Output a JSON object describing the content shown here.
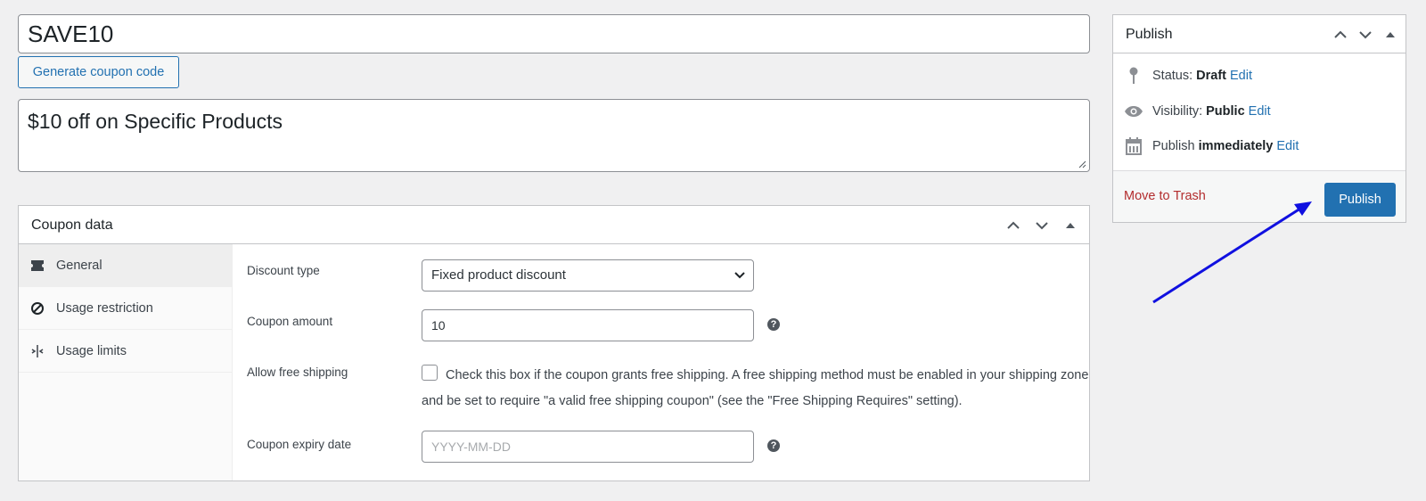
{
  "coupon": {
    "code": "SAVE10",
    "generate_label": "Generate coupon code",
    "description": "$10 off on Specific Products"
  },
  "coupon_data": {
    "title": "Coupon data",
    "tabs": [
      {
        "label": "General",
        "icon": "ticket-icon",
        "active": true
      },
      {
        "label": "Usage restriction",
        "icon": "block-icon",
        "active": false
      },
      {
        "label": "Usage limits",
        "icon": "limits-icon",
        "active": false
      }
    ],
    "fields": {
      "discount_type_label": "Discount type",
      "discount_type_value": "Fixed product discount",
      "coupon_amount_label": "Coupon amount",
      "coupon_amount_value": "10",
      "free_shipping_label": "Allow free shipping",
      "free_shipping_text": "Check this box if the coupon grants free shipping. A free shipping method must be enabled in your shipping zone and be set to require \"a valid free shipping coupon\" (see the \"Free Shipping Requires\" setting).",
      "expiry_label": "Coupon expiry date",
      "expiry_placeholder": "YYYY-MM-DD"
    }
  },
  "publish": {
    "title": "Publish",
    "status_label": "Status:",
    "status_value": "Draft",
    "visibility_label": "Visibility:",
    "visibility_value": "Public",
    "publish_label": "Publish",
    "publish_value": "immediately",
    "edit_label": "Edit",
    "trash_label": "Move to Trash",
    "button_label": "Publish"
  },
  "colors": {
    "accent": "#2271b1",
    "trash": "#b32d2e",
    "annotation_arrow": "#1010e0"
  }
}
